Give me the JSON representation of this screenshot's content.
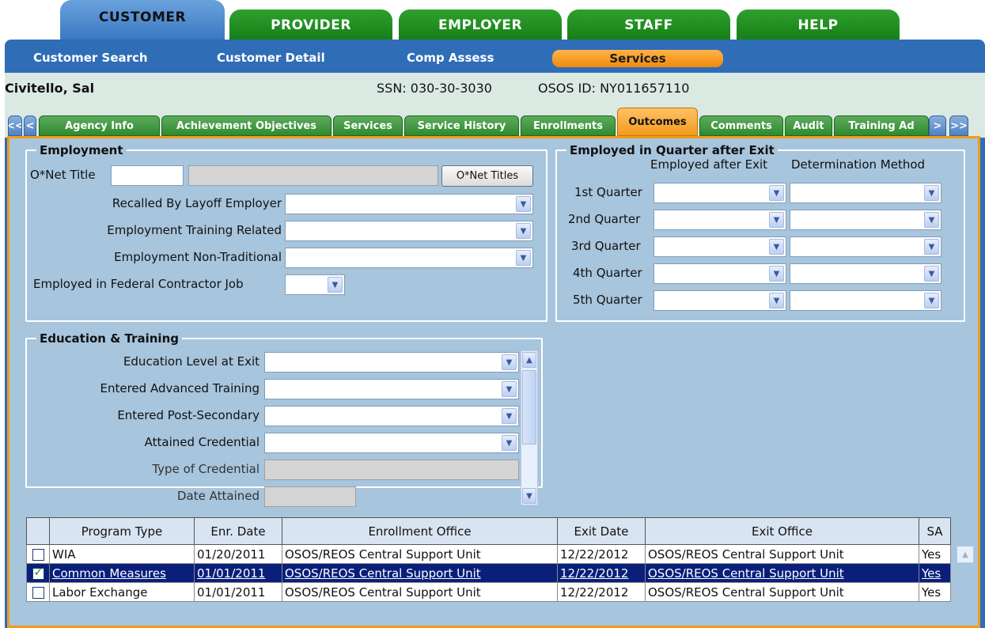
{
  "top_tabs": [
    "CUSTOMER",
    "PROVIDER",
    "EMPLOYER",
    "STAFF",
    "HELP"
  ],
  "subnav": [
    "Customer Search",
    "Customer Detail",
    "Comp Assess",
    "Services"
  ],
  "customer": {
    "name": "Civitello, Sal",
    "ssn": "SSN: 030-30-3030",
    "osos_id": "OSOS ID: NY011657110"
  },
  "tabs": {
    "first": "<<",
    "prev": "<",
    "next": ">",
    "last": ">>",
    "items": [
      "Agency Info",
      "Achievement Objectives",
      "Services",
      "Service History",
      "Enrollments",
      "Outcomes",
      "Comments",
      "Audit",
      "Training Ad"
    ]
  },
  "employment": {
    "legend": "Employment",
    "onet_label": "O*Net Title",
    "onet_value": "",
    "onet_button": "O*Net Titles",
    "recalled_label": "Recalled By Layoff Employer",
    "training_related_label": "Employment Training Related",
    "non_traditional_label": "Employment Non-Traditional",
    "federal_label": "Employed in Federal Contractor Job"
  },
  "quarters": {
    "legend": "Employed in Quarter after Exit",
    "col1": "Employed after Exit",
    "col2": "Determination Method",
    "rows": [
      "1st Quarter",
      "2nd Quarter",
      "3rd Quarter",
      "4th Quarter",
      "5th Quarter"
    ]
  },
  "education": {
    "legend": "Education & Training",
    "level_label": "Education Level at Exit",
    "advanced_label": "Entered Advanced Training",
    "post_secondary_label": "Entered Post-Secondary",
    "credential_label": "Attained Credential",
    "type_label": "Type of Credential",
    "date_label": "Date Attained"
  },
  "table": {
    "headers": [
      "Program Type",
      "Enr. Date",
      "Enrollment Office",
      "Exit Date",
      "Exit Office",
      "SA"
    ],
    "rows": [
      {
        "checked": false,
        "program": "WIA",
        "enr_date": "01/20/2011",
        "enr_office": "OSOS/REOS Central Support Unit",
        "exit_date": "12/22/2012",
        "exit_office": "OSOS/REOS Central Support Unit",
        "sa": "Yes"
      },
      {
        "checked": true,
        "program": "Common Measures",
        "enr_date": "01/01/2011",
        "enr_office": "OSOS/REOS Central Support Unit",
        "exit_date": "12/22/2012",
        "exit_office": "OSOS/REOS Central Support Unit",
        "sa": "Yes"
      },
      {
        "checked": false,
        "program": "Labor Exchange",
        "enr_date": "01/01/2011",
        "enr_office": "OSOS/REOS Central Support Unit",
        "exit_date": "12/22/2012",
        "exit_office": "OSOS/REOS Central Support Unit",
        "sa": "Yes"
      }
    ]
  }
}
